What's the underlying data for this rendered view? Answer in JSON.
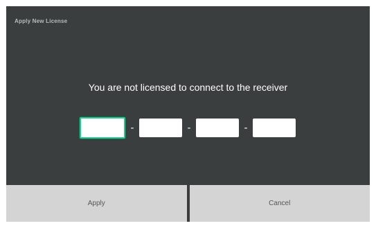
{
  "dialog": {
    "title": "Apply New License",
    "message": "You are not licensed to connect to the receiver",
    "license_key": {
      "segments": [
        {
          "value": "",
          "focused": true
        },
        {
          "value": "",
          "focused": false
        },
        {
          "value": "",
          "focused": false
        },
        {
          "value": "",
          "focused": false
        }
      ],
      "separator": "-"
    },
    "buttons": {
      "apply_label": "Apply",
      "cancel_label": "Cancel"
    }
  },
  "colors": {
    "dialog_background": "#3a3e3f",
    "focus_border": "#25c98f",
    "button_background": "#d4d4d4"
  }
}
